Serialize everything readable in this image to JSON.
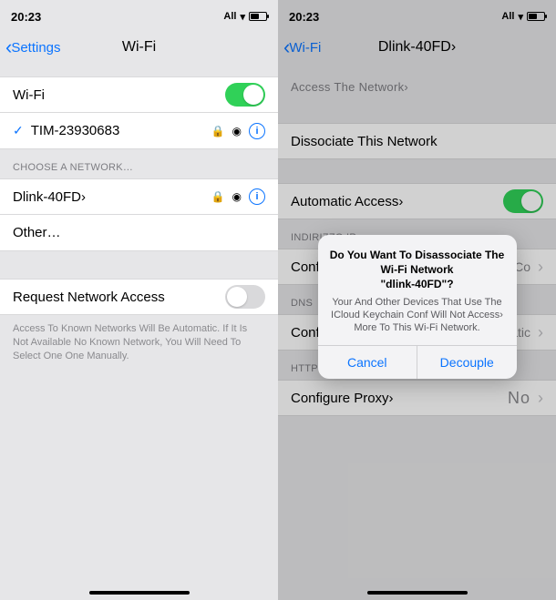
{
  "left": {
    "status": {
      "time": "20:23",
      "carrier": "All"
    },
    "nav": {
      "back": "Settings",
      "title": "Wi-Fi"
    },
    "wifi_row": {
      "label": "Wi-Fi",
      "on": true
    },
    "connected": {
      "name": "TIM-23930683"
    },
    "choose_label": "CHOOSE A NETWORK…",
    "networks": [
      {
        "name": "Dlink-40FD›"
      }
    ],
    "other": "Other…",
    "request_row": "Request Network Access",
    "footer": "Access To Known Networks Will Be Automatic. If It Is Not Available No Known Network, You Will Need To Select One One Manually."
  },
  "right": {
    "status": {
      "time": "20:23",
      "carrier": "All"
    },
    "nav": {
      "back": "Wi-Fi",
      "title": "Dlink-40FD›"
    },
    "access_label": "Access The Network›",
    "dissociate": "Dissociate This Network",
    "auto_row": {
      "label": "Automatic Access›"
    },
    "section_ip": "INDIRIZZO IP",
    "ip_row": {
      "label": "Configure IP",
      "value": "Auto Co"
    },
    "section_dns": "DNS",
    "dns_row": {
      "label": "Configure DNS›",
      "value": "Automatic"
    },
    "section_proxy": "HTTP PROXY›",
    "proxy_row": {
      "label": "Configure Proxy›",
      "value": "No"
    },
    "modal": {
      "title_line1": "Do You Want To Disassociate The Wi-Fi Network",
      "title_line2": "\"dlink-40FD\"?",
      "body": "Your And Other Devices That Use The ICloud Keychain Conf Will Not Access› More To This Wi-Fi Network.",
      "cancel": "Cancel",
      "confirm": "Decouple"
    }
  }
}
